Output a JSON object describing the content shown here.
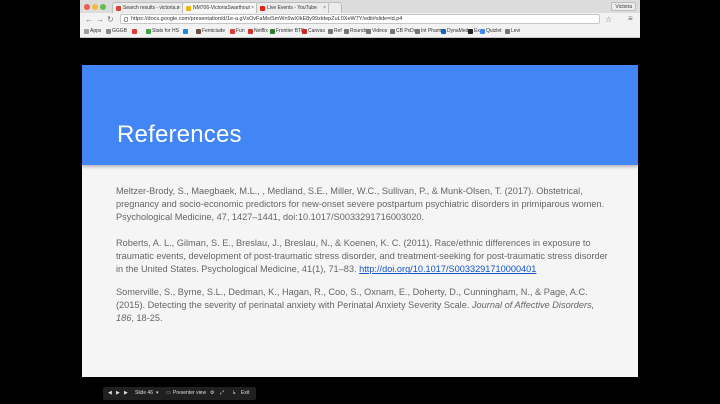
{
  "browser": {
    "tabs": [
      {
        "label": "Search results - victoria.s"
      },
      {
        "label": "NM706-VictoriaSwarthout"
      },
      {
        "label": "Live Events - YouTube"
      }
    ],
    "profile": "Victoria",
    "url": "https://docs.google.com/presentation/d/1e-a.gVsOvFaMsiSmWn9wXIkE8y99zldepZuL0XeW7Y/edit#slide=id.p4",
    "bookmarks": [
      {
        "label": "Apps",
        "color": "#9e9e9e"
      },
      {
        "label": "GGGB",
        "color": "#888888"
      },
      {
        "label": "",
        "color": "#e53935"
      },
      {
        "label": "Stats for HS",
        "color": "#43a047"
      },
      {
        "label": "",
        "color": "#1e88e5"
      },
      {
        "label": "Femiciude",
        "color": "#6d4c41"
      },
      {
        "label": "Fun",
        "color": "#e53935"
      },
      {
        "label": "Netflix",
        "color": "#d32f2f"
      },
      {
        "label": "Frontier BTF",
        "color": "#2e7d32"
      },
      {
        "label": "Canvas",
        "color": "#c62828"
      },
      {
        "label": "Ref",
        "color": "#757575"
      },
      {
        "label": "Rounds",
        "color": "#757575"
      },
      {
        "label": "Videos",
        "color": "#757575"
      },
      {
        "label": "CB PxDx",
        "color": "#757575"
      },
      {
        "label": "Int Pharm",
        "color": "#757575"
      },
      {
        "label": "DynaMed",
        "color": "#1565c0"
      },
      {
        "label": "Ex",
        "color": "#212121"
      },
      {
        "label": "Quizlet",
        "color": "#4285f4"
      },
      {
        "label": "Levi",
        "color": "#757575"
      }
    ]
  },
  "slide": {
    "title": "References",
    "references": [
      {
        "text": "Meltzer-Brody, S., Maegbaek, M.L., , Medland, S.E., Miller, W.C., Sullivan, P., & Munk-Olsen, T. (2017). Obstetrical, pregnancy and socio-economic predictors for new-onset severe postpartum psychiatric disorders in primiparous women. Psychological Medicine, 47, 1427–1441, doi:10.1017/S0033291716003020."
      },
      {
        "text": "Roberts, A. L., Gilman, S. E., Breslau, J., Breslau, N., & Koenen, K. C. (2011). Race/ethnic differences in exposure to traumatic events, development of post-traumatic stress disorder, and treatment-seeking for post-traumatic stress disorder in the United States. Psychological Medicine, 41(1), 71–83. ",
        "link": "http://doi.org/10.1017/S0033291710000401"
      },
      {
        "text": "Somerville, S., Byrne, S.L., Dedman, K., Hagan, R., Coo, S., Oxnam, E., Doherty, D., Cunningham, N., & Page, A.C. (2015). Detecting the severity of perinatal anxiety with Perinatal Anxiety Severity Scale. ",
        "journal": "Journal of Affective Disorders, 186",
        "tail": ", 18-25."
      }
    ]
  },
  "presenter": {
    "slide_label": "Slide 46",
    "presenter_view": "Presenter view",
    "exit": "Exit"
  }
}
